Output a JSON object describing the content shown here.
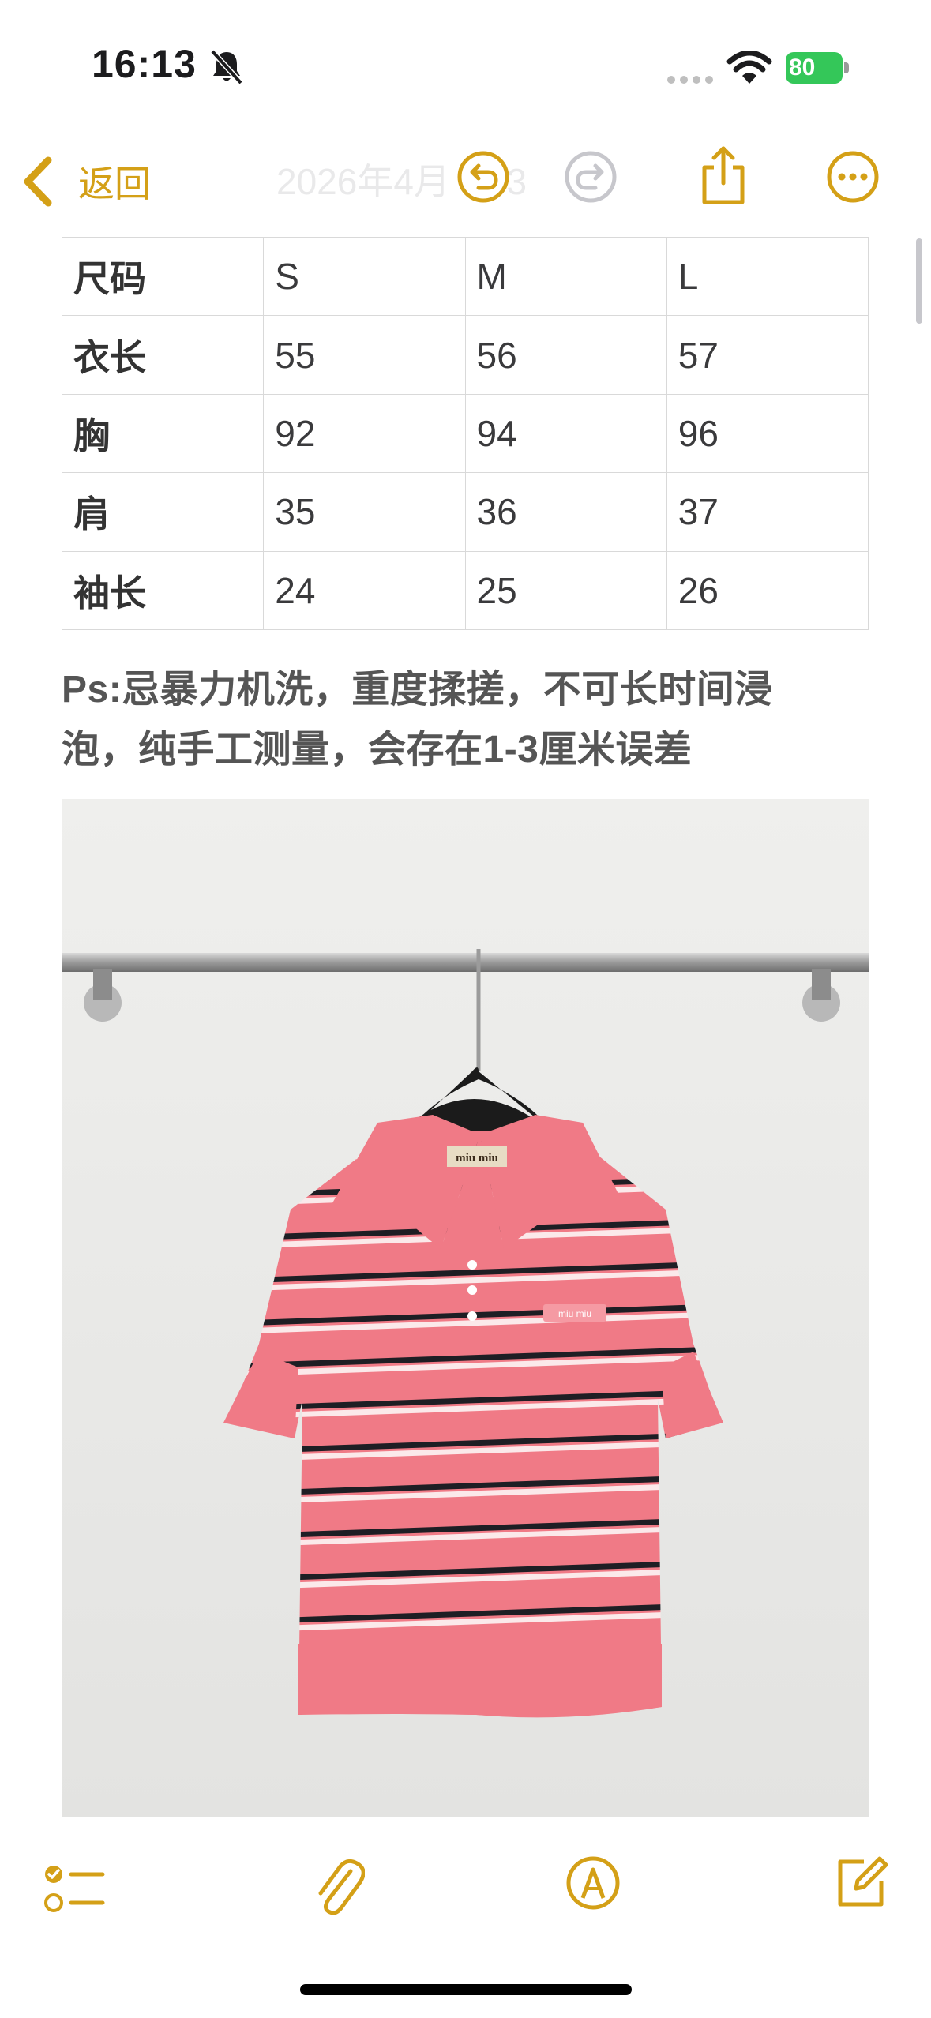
{
  "status_bar": {
    "time": "16:13",
    "battery_level": "80",
    "icons": [
      "bell-slash-icon",
      "signal-icon",
      "wifi-icon",
      "battery-charging-icon"
    ]
  },
  "nav": {
    "back_label": "返回",
    "faded_title": "2026年4月 日 3",
    "icons": [
      "chevron-left-icon",
      "undo-icon",
      "redo-icon",
      "share-icon",
      "more-icon"
    ]
  },
  "size_table": {
    "rows": [
      [
        "尺码",
        "S",
        "M",
        "L"
      ],
      [
        "衣长",
        "55",
        "56",
        "57"
      ],
      [
        "胸",
        "92",
        "94",
        "96"
      ],
      [
        "肩",
        "35",
        "36",
        "37"
      ],
      [
        "袖长",
        "24",
        "25",
        "26"
      ]
    ]
  },
  "note": {
    "line1": "Ps:忌暴力机洗，重度揉搓，不可长时间浸",
    "line2": "泡，纯手工测量，会存在1-3厘米误差"
  },
  "photo": {
    "label_text": "miu miu"
  },
  "toolbar": {
    "icons": [
      "checklist-icon",
      "paperclip-icon",
      "markup-pen-icon",
      "compose-icon"
    ]
  },
  "colors": {
    "accent": "#d4a017",
    "battery": "#34c759",
    "shirt_pink": "#f07a86"
  }
}
